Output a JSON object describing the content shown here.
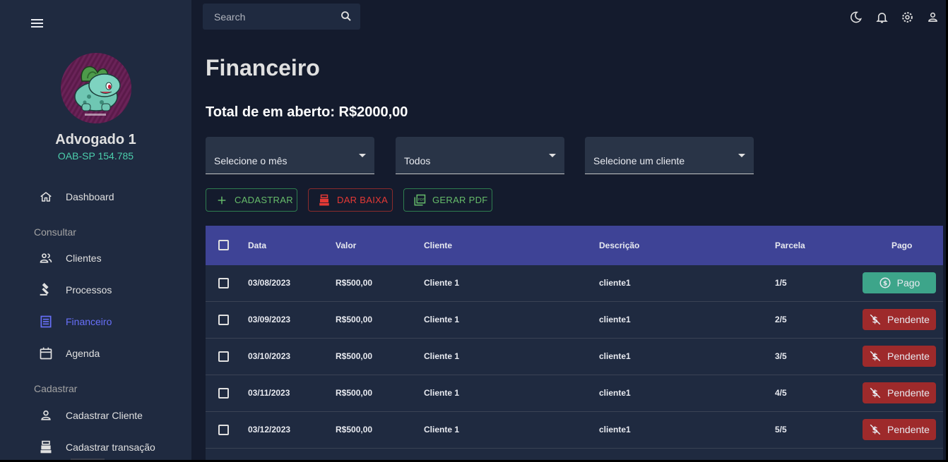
{
  "sidebar": {
    "user": {
      "name": "Advogado 1",
      "oab": "OAB-SP 154.785"
    },
    "items": [
      {
        "label": "Dashboard",
        "icon": "home-icon"
      },
      {
        "label": "Clientes",
        "icon": "people-icon"
      },
      {
        "label": "Processos",
        "icon": "gavel-icon"
      },
      {
        "label": "Financeiro",
        "icon": "receipt-icon",
        "active": true
      },
      {
        "label": "Agenda",
        "icon": "calendar-icon"
      },
      {
        "label": "Cadastrar Cliente",
        "icon": "person-icon"
      },
      {
        "label": "Cadastrar transação",
        "icon": "cash-register-icon"
      }
    ],
    "sections": {
      "consultar": "Consultar",
      "cadastrar": "Cadastrar"
    }
  },
  "topbar": {
    "search_placeholder": "Search",
    "icons": [
      "dark-mode-icon",
      "notifications-icon",
      "settings-icon",
      "profile-icon"
    ]
  },
  "main": {
    "title": "Financeiro",
    "total": "Total de em aberto: R$2000,00",
    "filters": {
      "month": "Selecione o mês",
      "status": "Todos",
      "client": "Selecione um cliente"
    },
    "actions": {
      "add": "CADASTRAR",
      "writeoff": "DAR BAIXA",
      "pdf": "GERAR PDF"
    }
  },
  "table": {
    "headers": {
      "date": "Data",
      "value": "Valor",
      "client": "Cliente",
      "description": "Descrição",
      "installment": "Parcela",
      "paid": "Pago"
    },
    "rows": [
      {
        "date": "03/08/2023",
        "value": "R$500,00",
        "client": "Cliente 1",
        "description": "cliente1",
        "installment": "1/5",
        "status": "Pago"
      },
      {
        "date": "03/09/2023",
        "value": "R$500,00",
        "client": "Cliente 1",
        "description": "cliente1",
        "installment": "2/5",
        "status": "Pendente"
      },
      {
        "date": "03/10/2023",
        "value": "R$500,00",
        "client": "Cliente 1",
        "description": "cliente1",
        "installment": "3/5",
        "status": "Pendente"
      },
      {
        "date": "03/11/2023",
        "value": "R$500,00",
        "client": "Cliente 1",
        "description": "cliente1",
        "installment": "4/5",
        "status": "Pendente"
      },
      {
        "date": "03/12/2023",
        "value": "R$500,00",
        "client": "Cliente 1",
        "description": "cliente1",
        "installment": "5/5",
        "status": "Pendente"
      }
    ]
  },
  "colors": {
    "accent": "#6870fa",
    "green": "#4cceac",
    "paid": "#3da58a",
    "pending": "#9e2a2b",
    "table_header": "#3e4396"
  }
}
